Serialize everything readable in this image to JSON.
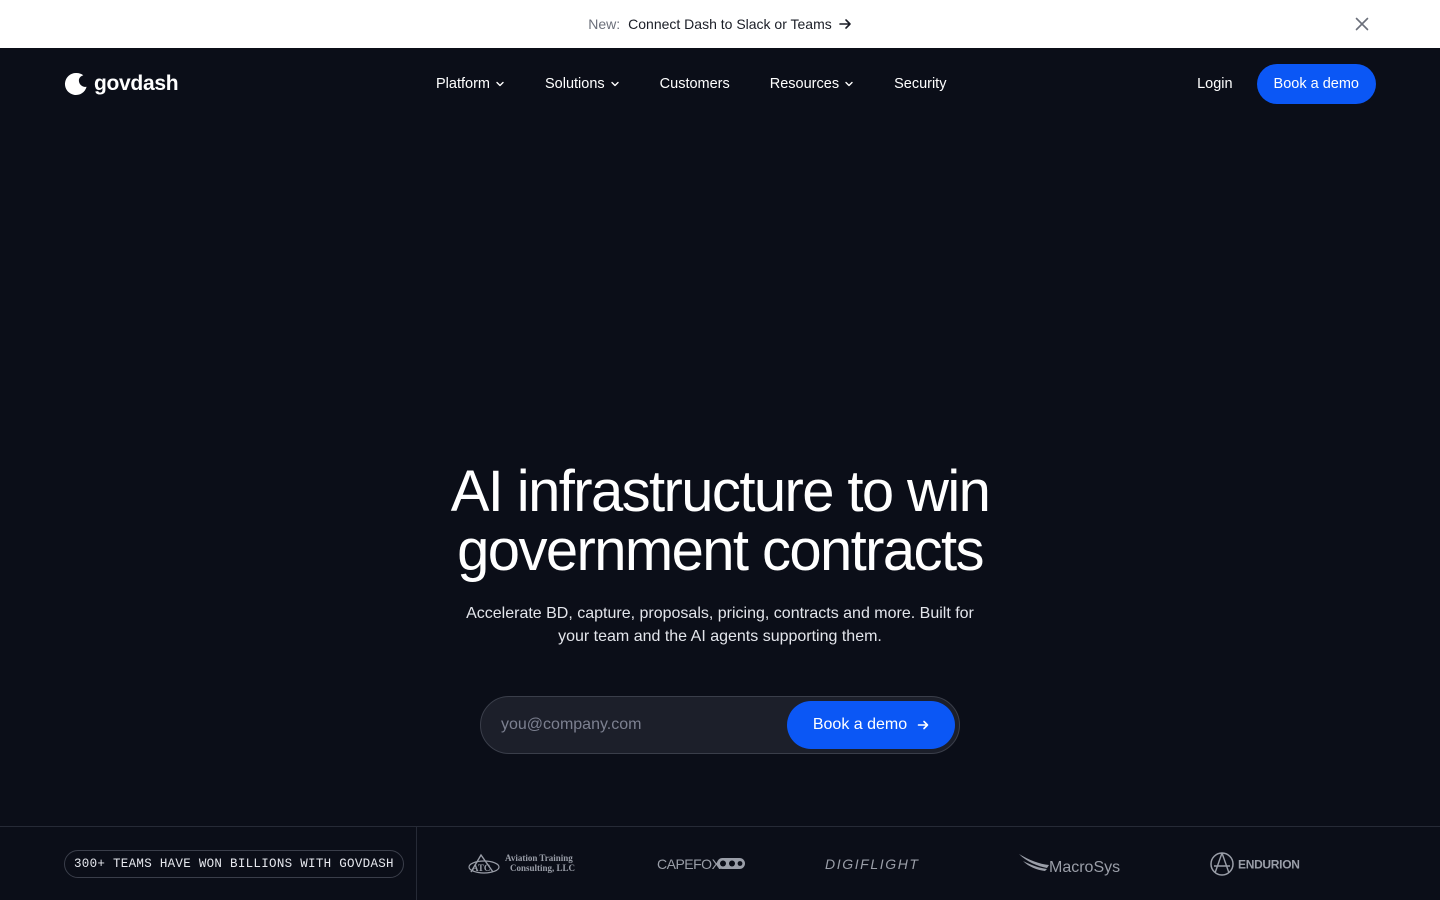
{
  "announcement": {
    "prefix": "New:",
    "link_text": "Connect Dash to Slack or Teams"
  },
  "nav": {
    "brand": "govdash",
    "items": [
      {
        "label": "Platform",
        "has_dropdown": true
      },
      {
        "label": "Solutions",
        "has_dropdown": true
      },
      {
        "label": "Customers",
        "has_dropdown": false
      },
      {
        "label": "Resources",
        "has_dropdown": true
      },
      {
        "label": "Security",
        "has_dropdown": false
      }
    ],
    "login": "Login",
    "cta": "Book a demo"
  },
  "hero": {
    "title_line1": "AI infrastructure to win",
    "title_line2": "government contracts",
    "subtitle_line1": "Accelerate BD, capture, proposals, pricing, contracts and more. Built for",
    "subtitle_line2": "your team and the AI agents supporting them.",
    "email_placeholder": "you@company.com",
    "submit_label": "Book a demo"
  },
  "social_proof": {
    "badge": "300+ TEAMS HAVE WON BILLIONS WITH GOVDASH",
    "logos": [
      {
        "name": "Aviation Training Consulting, LLC",
        "mark": "ATC",
        "line1": "Aviation Training",
        "line2": "Consulting, LLC"
      },
      {
        "name": "CapeFox",
        "text": "CAPEFOX"
      },
      {
        "name": "DigiFlight",
        "text": "DIGIFLIGHT"
      },
      {
        "name": "MacroSys",
        "text": "MacroSys"
      },
      {
        "name": "Endurion",
        "text": "ENDURION"
      }
    ]
  },
  "colors": {
    "background": "#0b0e18",
    "accent": "#0b57f5",
    "announcement_bg": "#ffffff"
  },
  "icons": [
    "arrow-right-icon",
    "close-icon",
    "chevron-down-icon",
    "govdash-logo-icon"
  ]
}
